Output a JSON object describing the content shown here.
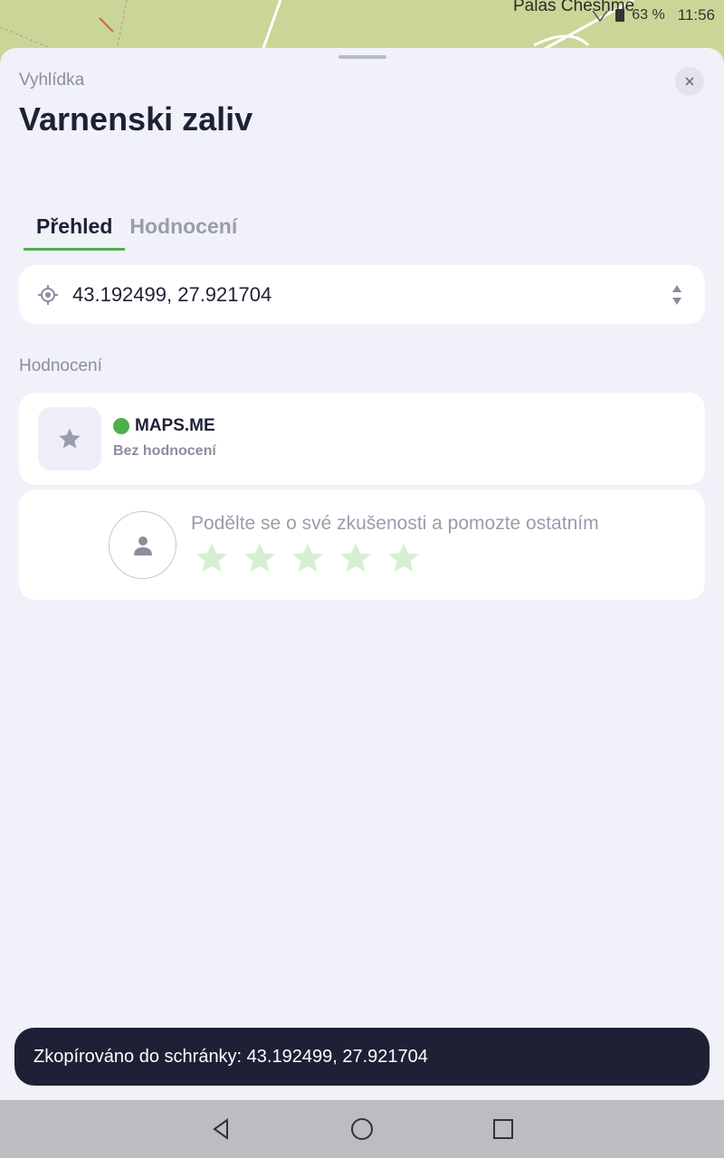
{
  "map": {
    "label": "Palas Cheshme"
  },
  "status_bar": {
    "battery": "63 %",
    "time": "11:56"
  },
  "sheet": {
    "subtitle": "Vyhlídka",
    "title": "Varnenski zaliv",
    "close_icon": "close-icon"
  },
  "tabs": [
    {
      "label": "Přehled",
      "active": true
    },
    {
      "label": "Hodnocení",
      "active": false
    }
  ],
  "coordinates": {
    "value": "43.192499, 27.921704",
    "icon": "location-target-icon"
  },
  "ratings_section": {
    "label": "Hodnocení",
    "source": "MAPS.ME",
    "status": "Bez hodnocení"
  },
  "review": {
    "prompt": "Podělte se o své zkušenosti a pomozte ostatním",
    "star_count": 5
  },
  "toast": {
    "message": "Zkopírováno do schránky: 43.192499, 27.921704"
  },
  "colors": {
    "accent": "#4fae4e",
    "dark": "#1e2035",
    "muted": "#8b8e9b",
    "star": "#d6efd2"
  }
}
